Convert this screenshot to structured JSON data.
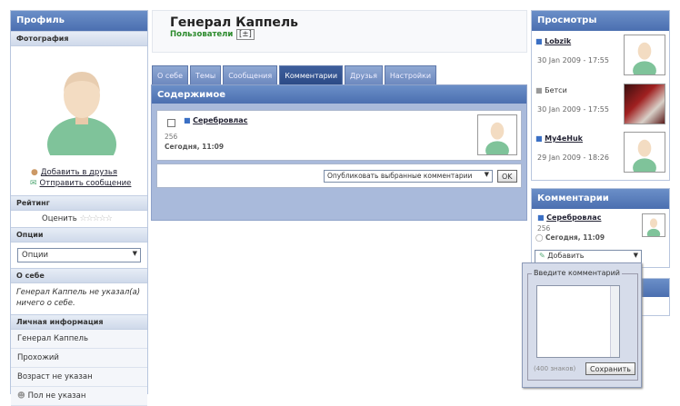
{
  "profile": {
    "header": "Профиль",
    "photo_label": "Фотография",
    "add_friend": "Добавить в друзья",
    "send_message": "Отправить сообщение",
    "rating_label": "Рейтинг",
    "rate_text": "Оценить",
    "rating_stars": "☆☆☆☆☆",
    "options_label": "Опции",
    "options_select": "Опции",
    "about_label": "О себе",
    "about_text": "Генерал Каппель не указал(а) ничего о себе.",
    "personal_label": "Личная информация",
    "info": [
      "Генерал Каппель",
      "Прохожий",
      "Возраст не указан",
      "Пол не указан"
    ]
  },
  "page": {
    "title": "Генерал Каппель",
    "subtitle": "Пользователи",
    "toggle": "[±]"
  },
  "tabs": [
    "О себе",
    "Темы",
    "Сообщения",
    "Комментарии",
    "Друзья",
    "Настройки"
  ],
  "content": {
    "header": "Содержимое",
    "comment": {
      "author": "Серебровлас",
      "text": "256",
      "date": "Сегодня, 11:09"
    },
    "publish_select": "Опубликовать выбранные комментарии",
    "ok_button": "OK"
  },
  "views": {
    "header": "Просмотры",
    "items": [
      {
        "name": "Lobzik",
        "date": "30 Jan 2009 - 17:55"
      },
      {
        "name": "Бетси",
        "date": "30 Jan 2009 - 17:55"
      },
      {
        "name": "My4eHuk",
        "date": "29 Jan 2009 - 18:26"
      }
    ]
  },
  "comments_box": {
    "header": "Комментарии",
    "author": "Серебровлас",
    "text": "256",
    "date": "Сегодня, 11:09",
    "add_select": "Добавить"
  },
  "popup": {
    "legend": "Введите комментарий",
    "counter": "(400 знаков)",
    "save_button": "Сохранить"
  }
}
